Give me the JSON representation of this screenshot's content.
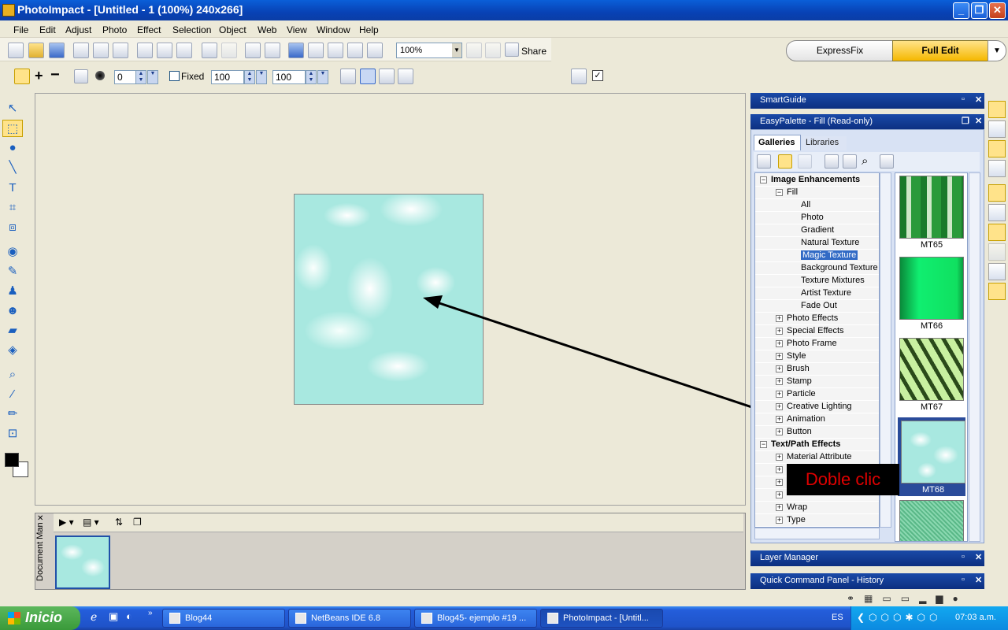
{
  "window": {
    "title": "PhotoImpact - [Untitled - 1 (100%) 240x266]",
    "minimize": "_",
    "restore": "❐",
    "close": "✕"
  },
  "menu": [
    "File",
    "Edit",
    "Adjust",
    "Photo",
    "Effect",
    "Selection",
    "Object",
    "Web",
    "View",
    "Window",
    "Help"
  ],
  "toolbar": {
    "zoom": "100%",
    "share": "Share"
  },
  "modes": {
    "express": "ExpressFix",
    "full": "Full Edit"
  },
  "attributes": {
    "value1": "0",
    "fixed_label": "Fixed",
    "width": "100",
    "height": "100"
  },
  "panels": {
    "smartguide": "SmartGuide",
    "easypalette": "EasyPalette - Fill (Read-only)",
    "layer_manager": "Layer Manager",
    "quick_command": "Quick Command Panel - History",
    "tabs": {
      "galleries": "Galleries",
      "libraries": "Libraries"
    }
  },
  "tree": [
    {
      "label": "Image Enhancements",
      "level": 0,
      "box": "⊟",
      "bold": true
    },
    {
      "label": "Fill",
      "level": 1,
      "box": "⊟"
    },
    {
      "label": "All",
      "level": 2
    },
    {
      "label": "Photo",
      "level": 2
    },
    {
      "label": "Gradient",
      "level": 2
    },
    {
      "label": "Natural Texture",
      "level": 2
    },
    {
      "label": "Magic Texture",
      "level": 2,
      "selected": true
    },
    {
      "label": "Background Texture",
      "level": 2
    },
    {
      "label": "Texture Mixtures",
      "level": 2
    },
    {
      "label": "Artist Texture",
      "level": 2
    },
    {
      "label": "Fade Out",
      "level": 2
    },
    {
      "label": "Photo Effects",
      "level": 1,
      "box": "⊞"
    },
    {
      "label": "Special Effects",
      "level": 1,
      "box": "⊞"
    },
    {
      "label": "Photo Frame",
      "level": 1,
      "box": "⊞"
    },
    {
      "label": "Style",
      "level": 1,
      "box": "⊞"
    },
    {
      "label": "Brush",
      "level": 1,
      "box": "⊞"
    },
    {
      "label": "Stamp",
      "level": 1,
      "box": "⊞"
    },
    {
      "label": "Particle",
      "level": 1,
      "box": "⊞"
    },
    {
      "label": "Creative Lighting",
      "level": 1,
      "box": "⊞"
    },
    {
      "label": "Animation",
      "level": 1,
      "box": "⊞"
    },
    {
      "label": "Button",
      "level": 1,
      "box": "⊞"
    },
    {
      "label": "Text/Path Effects",
      "level": 0,
      "box": "⊟",
      "bold": true
    },
    {
      "label": "Material Attribute",
      "level": 1,
      "box": "⊞"
    },
    {
      "label": "",
      "level": 1,
      "box": "⊞"
    },
    {
      "label": "",
      "level": 1,
      "box": "⊞"
    },
    {
      "label": "",
      "level": 1,
      "box": "⊞"
    },
    {
      "label": "Wrap",
      "level": 1,
      "box": "⊞"
    },
    {
      "label": "Type",
      "level": 1,
      "box": "⊞"
    }
  ],
  "thumbnails": [
    {
      "label": "MT65",
      "color": "#2a9a3a"
    },
    {
      "label": "MT66",
      "color": "#10e060"
    },
    {
      "label": "MT67",
      "color": "#a8d880"
    },
    {
      "label": "MT68",
      "color": "#a8e8e0",
      "selected": true
    },
    {
      "label": "",
      "color": "#60b890"
    }
  ],
  "document_manager": {
    "title": "Document Man"
  },
  "callout": {
    "text": "Doble clic"
  },
  "taskbar": {
    "start": "Inicio",
    "tasks": [
      "Blog44",
      "NetBeans IDE 6.8",
      "Blog45- ejemplo #19 ...",
      "PhotoImpact - [Untitl..."
    ],
    "lang": "ES",
    "clock": "07:03 a.m."
  }
}
